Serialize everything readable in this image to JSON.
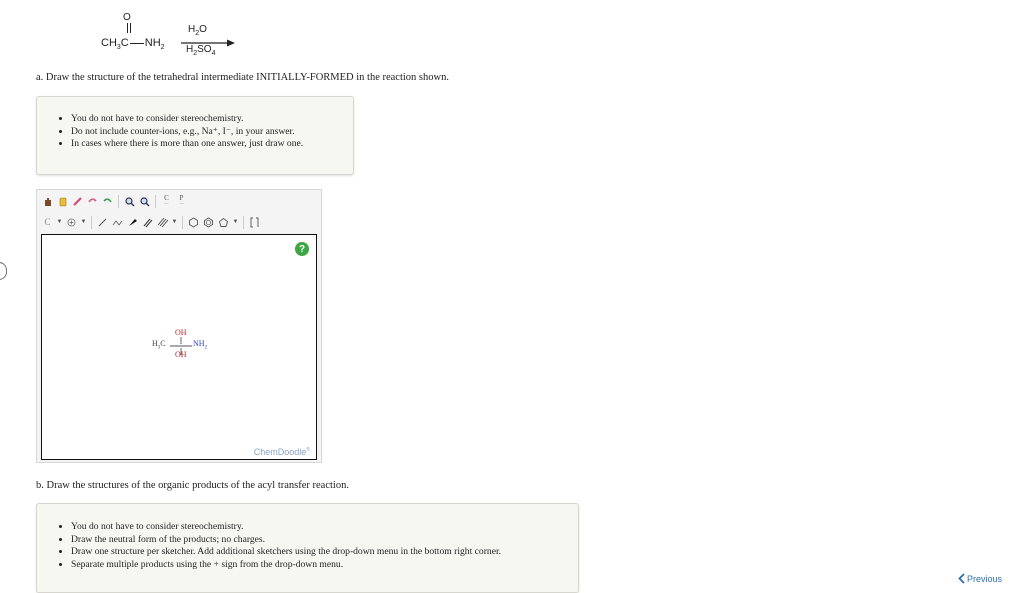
{
  "reaction": {
    "carbonyl_o": "O",
    "substrate_left": "CH",
    "substrate_sub3": "3",
    "substrate_c": "C",
    "substrate_nh": "NH",
    "substrate_sub2": "2",
    "reagent_top": "H",
    "reagent_top_sub": "2",
    "reagent_top_tail": "O",
    "reagent_bottom": "H",
    "reagent_bottom_sub2": "2",
    "reagent_bottom_mid": "SO",
    "reagent_bottom_sub4": "4"
  },
  "part_a": {
    "question": "a. Draw the structure of the tetrahedral intermediate INITIALLY-FORMED in the reaction shown.",
    "hints": [
      "You do not have to consider stereochemistry.",
      "Do not include counter-ions, e.g., Na⁺, I⁻, in your answer.",
      "In cases where there is more than one answer, just draw one."
    ]
  },
  "sketcher": {
    "toolbar_top": [
      "hand-icon",
      "erase-icon",
      "pen-icon",
      "undo-icon",
      "redo-icon",
      "zoom-in-icon",
      "zoom-out-icon",
      "clean-icon",
      "perspective-icon"
    ],
    "perspective_label": "P",
    "clean_label": "C",
    "help_label": "?",
    "brand": "ChemDoodle",
    "brand_mark": "®",
    "molecule": {
      "top": "OH",
      "left": "H",
      "left_sub": "3",
      "left_c": "C",
      "right": "NH",
      "right_sub": "2",
      "bottom": "OH"
    }
  },
  "part_b": {
    "question": "b. Draw the structures of the organic products of the acyl transfer reaction.",
    "hints": [
      "You do not have to consider stereochemistry.",
      "Draw the neutral form of the products; no charges.",
      "Draw one structure per sketcher. Add additional sketchers using the drop-down menu in the bottom right corner.",
      "Separate multiple products using the + sign from the drop-down menu."
    ]
  },
  "nav": {
    "previous": "Previous",
    "previous_icon": "chevron-left-icon"
  }
}
